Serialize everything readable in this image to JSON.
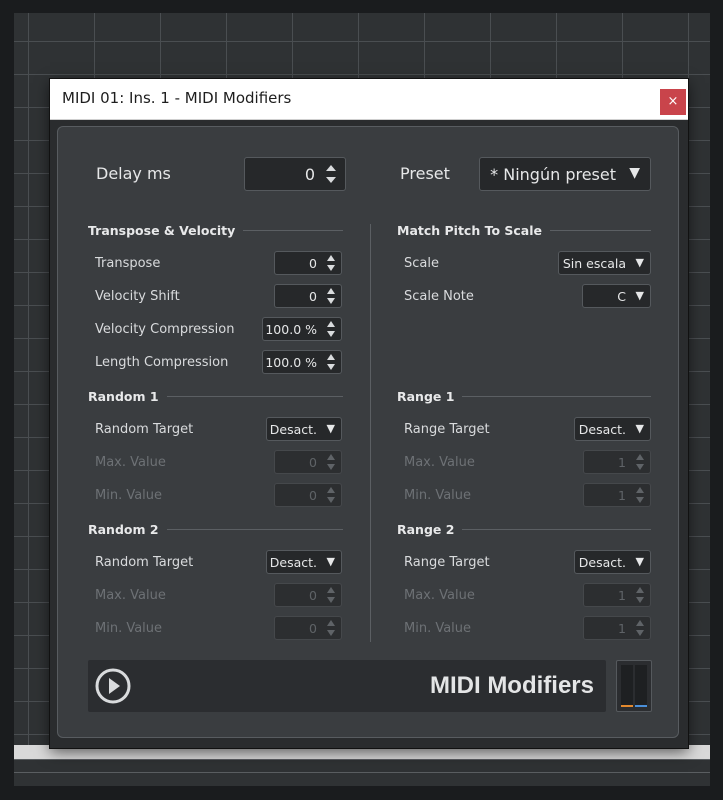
{
  "window": {
    "title": "MIDI 01: Ins. 1 - MIDI Modifiers",
    "close_glyph": "×"
  },
  "top": {
    "delay_label": "Delay ms",
    "delay_value": "0",
    "preset_label": "Preset",
    "preset_value": "* Ningún preset"
  },
  "transpose_velocity": {
    "title": "Transpose & Velocity",
    "transpose": {
      "label": "Transpose",
      "value": "0"
    },
    "velocity_shift": {
      "label": "Velocity Shift",
      "value": "0"
    },
    "velocity_compression": {
      "label": "Velocity Compression",
      "value": "100.0 %"
    },
    "length_compression": {
      "label": "Length Compression",
      "value": "100.0 %"
    }
  },
  "match_pitch": {
    "title": "Match Pitch To Scale",
    "scale": {
      "label": "Scale",
      "value": "Sin escala"
    },
    "scale_note": {
      "label": "Scale Note",
      "value": "C"
    }
  },
  "random1": {
    "title": "Random 1",
    "target": {
      "label": "Random Target",
      "value": "Desact."
    },
    "max": {
      "label": "Max. Value",
      "value": "0"
    },
    "min": {
      "label": "Min. Value",
      "value": "0"
    }
  },
  "random2": {
    "title": "Random 2",
    "target": {
      "label": "Random Target",
      "value": "Desact."
    },
    "max": {
      "label": "Max. Value",
      "value": "0"
    },
    "min": {
      "label": "Min. Value",
      "value": "0"
    }
  },
  "range1": {
    "title": "Range 1",
    "target": {
      "label": "Range Target",
      "value": "Desact."
    },
    "max": {
      "label": "Max. Value",
      "value": "1"
    },
    "min": {
      "label": "Min. Value",
      "value": "1"
    }
  },
  "range2": {
    "title": "Range 2",
    "target": {
      "label": "Range Target",
      "value": "Desact."
    },
    "max": {
      "label": "Max. Value",
      "value": "1"
    },
    "min": {
      "label": "Min. Value",
      "value": "1"
    }
  },
  "footer": {
    "plugin_name": "MIDI Modifiers"
  },
  "icons": {
    "dropdown": "▼",
    "play": "play-icon",
    "spin": "spinner-arrows-icon"
  },
  "colors": {
    "close": "#c9444b",
    "meter_left": "#e3892e",
    "meter_right": "#4a8fd9"
  }
}
